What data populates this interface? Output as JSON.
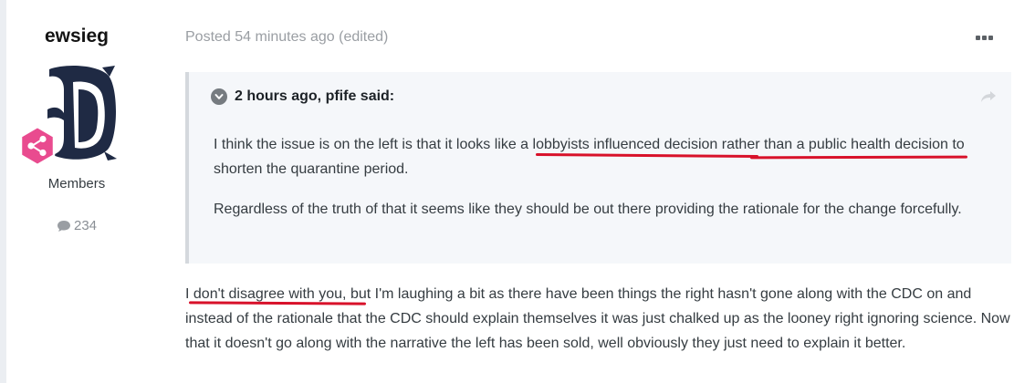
{
  "author": {
    "name": "ewsieg",
    "group": "Members",
    "post_count": "234",
    "avatar_icon": "old-english-d-logo",
    "badge_icon": "share-nodes-icon"
  },
  "post": {
    "meta": "Posted 54 minutes ago (edited)",
    "menu_icon": "ellipsis-icon"
  },
  "quote": {
    "citation": "2 hours ago, pfife said:",
    "paragraph1_part1": "I think the issue is on the left is that it looks ",
    "paragraph1_highlight": "like a lobbyists influenced decision rather than a public health",
    "paragraph1_part2": " decision to shorten the quarantine period.",
    "paragraph2": "Regardless of the truth of that it seems like they should be out there providing the rationale for the change forcefully."
  },
  "reply": {
    "highlight": "I don't disagree with you",
    "text": ", but I'm laughing a bit as there have been things the right hasn't gone along with the CDC on and instead of the rationale that the CDC should explain themselves it was just chalked up as the looney right ignoring science.  Now that it doesn't go along with the narrative the left has been sold, well obviously they just need to explain it better."
  },
  "colors": {
    "underline": "#d8112a",
    "badge": "#e94b8f",
    "avatar": "#1f2a44"
  }
}
